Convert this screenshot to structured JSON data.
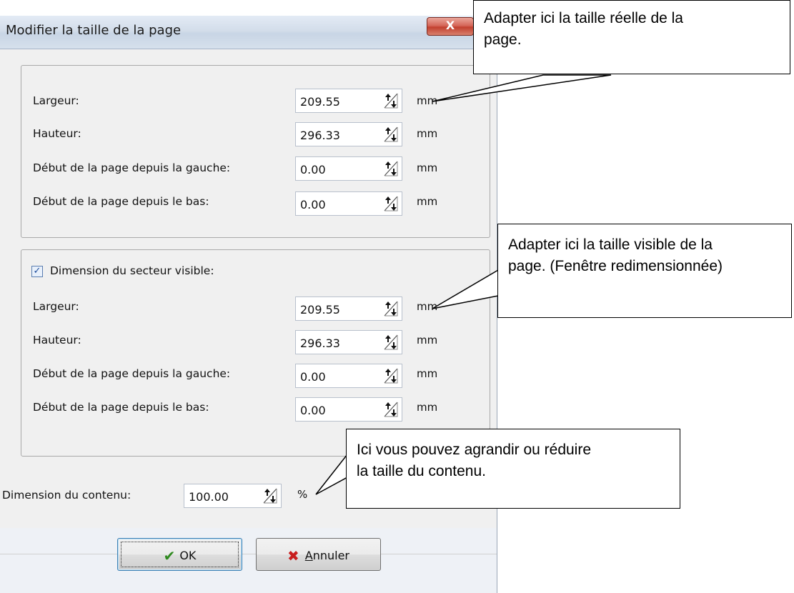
{
  "dialog": {
    "title": "Modifier la taille de la page",
    "close_glyph": "X"
  },
  "page_size": {
    "rows": [
      {
        "label": "Largeur:",
        "value": "209.55",
        "unit": "mm"
      },
      {
        "label": "Hauteur:",
        "value": "296.33",
        "unit": "mm"
      },
      {
        "label": "Début de la page depuis la gauche:",
        "value": "0.00",
        "unit": "mm"
      },
      {
        "label": "Début de la page depuis le bas:",
        "value": "0.00",
        "unit": "mm"
      }
    ]
  },
  "visible_area": {
    "checkbox_label": "Dimension du secteur visible:",
    "checked": true,
    "rows": [
      {
        "label": "Largeur:",
        "value": "209.55",
        "unit": "mm"
      },
      {
        "label": "Hauteur:",
        "value": "296.33",
        "unit": "mm"
      },
      {
        "label": "Début de la page depuis la gauche:",
        "value": "0.00",
        "unit": "mm"
      },
      {
        "label": "Début de la page depuis le bas:",
        "value": "0.00",
        "unit": "mm"
      }
    ]
  },
  "content_size": {
    "label": "Dimension du contenu:",
    "value": "100.00",
    "unit": "%"
  },
  "buttons": {
    "ok_label": "OK",
    "cancel_first_letter": "A",
    "cancel_rest": "nnuler"
  },
  "callouts": {
    "c1_line1": "Adapter ici la taille réelle de la",
    "c1_line2": "page.",
    "c2_line1": "Adapter ici la taille visible de la",
    "c2_line2": "page. (Fenêtre redimensionnée)",
    "c3_line1": "Ici vous pouvez agrandir ou réduire",
    "c3_line2": "la taille du contenu."
  },
  "icons": {
    "spin": "spin-arrows-icon",
    "ok": "checkmark-icon",
    "cancel": "red-x-icon",
    "checkbox": "checkbox-checked-icon"
  },
  "colors": {
    "ok_check": "#2f8a1f",
    "cancel_x": "#c81e1e",
    "close_button": "#c2402f"
  }
}
